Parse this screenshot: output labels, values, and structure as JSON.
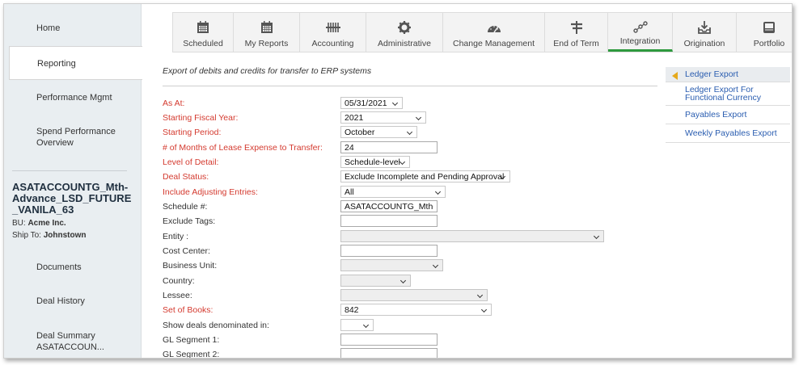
{
  "sidebar": {
    "items": [
      {
        "label": "Home"
      },
      {
        "label": "Reporting"
      },
      {
        "label": "Performance Mgmt"
      },
      {
        "label": "Spend Performance Overview"
      },
      {
        "label": "Documents"
      },
      {
        "label": "Deal History"
      },
      {
        "label": "Deal Summary ASATACCOUN..."
      }
    ],
    "deal": {
      "title": "ASATACCOUNTG_Mth-Advance_LSD_FUTURE_VANILA_63",
      "bu_label": "BU:",
      "bu_value": "Acme Inc.",
      "ship_label": "Ship To:",
      "ship_value": "Johnstown"
    }
  },
  "tabs": [
    {
      "label": "Scheduled",
      "icon": "calendar-icon"
    },
    {
      "label": "My Reports",
      "icon": "calendar-icon"
    },
    {
      "label": "Accounting",
      "icon": "ledger-icon"
    },
    {
      "label": "Administrative",
      "icon": "gear-icon"
    },
    {
      "label": "Change Management",
      "icon": "gauge-icon"
    },
    {
      "label": "End of Term",
      "icon": "signpost-icon"
    },
    {
      "label": "Integration",
      "icon": "nodes-icon",
      "active": true
    },
    {
      "label": "Origination",
      "icon": "tray-download-icon"
    },
    {
      "label": "Portfolio",
      "icon": "inbox-icon"
    }
  ],
  "main": {
    "subtitle": "Export of debits and credits for transfer to ERP systems",
    "fields": {
      "as_at": {
        "label": "As At:",
        "value": "05/31/2021"
      },
      "fiscal_year": {
        "label": "Starting Fiscal Year:",
        "value": "2021"
      },
      "period": {
        "label": "Starting Period:",
        "value": "October"
      },
      "months": {
        "label": "# of Months of Lease Expense to Transfer:",
        "value": "24"
      },
      "detail": {
        "label": "Level of Detail:",
        "value": "Schedule-level"
      },
      "deal_status": {
        "label": "Deal Status:",
        "value": "Exclude Incomplete and Pending Approval"
      },
      "adjusting": {
        "label": "Include Adjusting Entries:",
        "value": "All"
      },
      "schedule": {
        "label": "Schedule #:",
        "value": "ASATACCOUNTG_Mth-Ad"
      },
      "exclude_tags": {
        "label": "Exclude Tags:",
        "value": ""
      },
      "entity": {
        "label": "Entity :",
        "value": ""
      },
      "cost_center": {
        "label": "Cost Center:",
        "value": ""
      },
      "business_unit": {
        "label": "Business Unit:",
        "value": ""
      },
      "country": {
        "label": "Country:",
        "value": ""
      },
      "lessee": {
        "label": "Lessee:",
        "value": ""
      },
      "set_of_books": {
        "label": "Set of Books:",
        "value": "842"
      },
      "denominated": {
        "label": "Show deals denominated in:",
        "value": ""
      },
      "gl1": {
        "label": "GL Segment 1:",
        "value": ""
      },
      "gl2": {
        "label": "GL Segment 2:",
        "value": ""
      }
    }
  },
  "right_panel": {
    "items": [
      {
        "label": "Ledger Export"
      },
      {
        "label": "Ledger Export For Functional Currency"
      },
      {
        "label": "Payables Export"
      },
      {
        "label": "Weekly Payables Export"
      }
    ]
  },
  "colors": {
    "required": "#d43a2f",
    "link": "#2a5db0",
    "active_tab": "#2e9a3e",
    "arrow": "#e5a91c"
  }
}
